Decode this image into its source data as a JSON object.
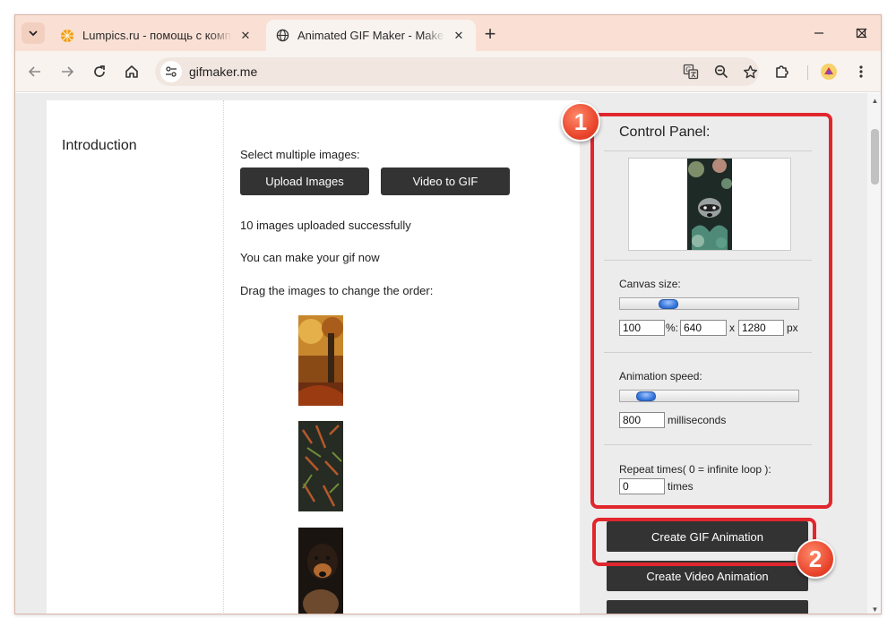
{
  "browser": {
    "tabs": [
      {
        "title": "Lumpics.ru - помощь с компьютером",
        "favicon": "orange-icon",
        "active": false
      },
      {
        "title": "Animated GIF Maker - Make GIFs",
        "favicon": "globe-icon",
        "active": true
      }
    ],
    "url": "gifmaker.me",
    "new_tab_label": "+"
  },
  "page": {
    "sidebar": {
      "intro": "Introduction"
    },
    "main": {
      "select_label": "Select multiple images:",
      "upload_button": "Upload Images",
      "video_button": "Video to GIF",
      "status_uploaded": "10 images uploaded successfully",
      "status_ready": "You can make your gif now",
      "drag_hint": "Drag the images to change the order:"
    },
    "control_panel": {
      "title": "Control Panel:",
      "canvas_label": "Canvas size:",
      "canvas_percent": "100",
      "percent_sep": "%:",
      "canvas_width": "640",
      "times_x": "x",
      "canvas_height": "1280",
      "px_unit": "px",
      "canvas_slider_level": 0.24,
      "speed_label": "Animation speed:",
      "speed_value": "800",
      "speed_unit": "milliseconds",
      "speed_slider_level": 0.1,
      "repeat_label": "Repeat times( 0 = infinite loop ):",
      "repeat_value": "0",
      "repeat_unit": "times",
      "create_gif_button": "Create GIF Animation",
      "create_video_button": "Create Video Animation"
    }
  },
  "annotations": {
    "badge1": "1",
    "badge2": "2",
    "color": "#e1262d"
  }
}
